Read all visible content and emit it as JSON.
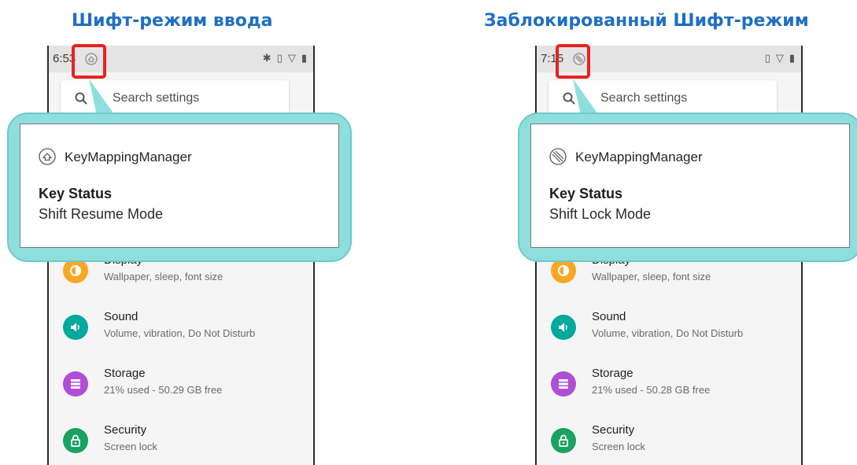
{
  "panels": [
    {
      "heading": "Шифт-режим ввода",
      "status_time": "6:53",
      "status_icon": "shift-resume-icon",
      "search_placeholder": "Search settings",
      "notification": {
        "app_name": "KeyMappingManager",
        "title": "Key Status",
        "text": "Shift Resume Mode"
      },
      "settings": [
        {
          "title": "Display",
          "subtitle": "Wallpaper, sleep, font size",
          "icon": "display-icon",
          "color": "#f9a825"
        },
        {
          "title": "Sound",
          "subtitle": "Volume, vibration, Do Not Disturb",
          "icon": "sound-icon",
          "color": "#00a99d"
        },
        {
          "title": "Storage",
          "subtitle": "21% used - 50.29 GB free",
          "icon": "storage-icon",
          "color": "#b04fd6"
        },
        {
          "title": "Security",
          "subtitle": "Screen lock",
          "icon": "lock-icon",
          "color": "#1aa260"
        }
      ]
    },
    {
      "heading": "Заблокированный Шифт-режим",
      "status_time": "7:15",
      "status_icon": "shift-lock-icon",
      "search_placeholder": "Search settings",
      "notification": {
        "app_name": "KeyMappingManager",
        "title": "Key Status",
        "text": "Shift Lock Mode"
      },
      "settings": [
        {
          "title": "Display",
          "subtitle": "Wallpaper, sleep, font size",
          "icon": "display-icon",
          "color": "#f9a825"
        },
        {
          "title": "Sound",
          "subtitle": "Volume, vibration, Do Not Disturb",
          "icon": "sound-icon",
          "color": "#00a99d"
        },
        {
          "title": "Storage",
          "subtitle": "21% used - 50.28 GB free",
          "icon": "storage-icon",
          "color": "#b04fd6"
        },
        {
          "title": "Security",
          "subtitle": "Screen lock",
          "icon": "lock-icon",
          "color": "#1aa260"
        }
      ]
    }
  ],
  "colors": {
    "heading": "#1f6fc4",
    "callout": "#8fdede",
    "highlight": "#e8231e"
  }
}
